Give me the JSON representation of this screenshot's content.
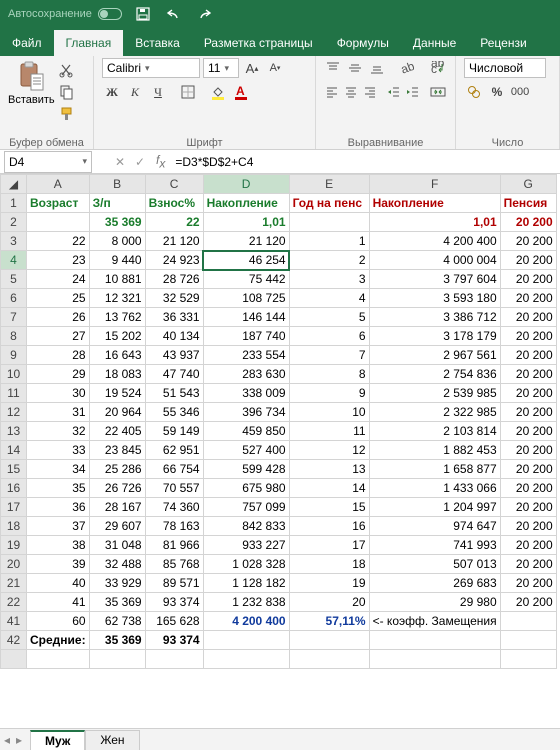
{
  "title_bar": {
    "autosave": "Автосохранение"
  },
  "tabs": [
    "Файл",
    "Главная",
    "Вставка",
    "Разметка страницы",
    "Формулы",
    "Данные",
    "Рецензи"
  ],
  "active_tab": 1,
  "ribbon": {
    "clipboard": {
      "paste": "Вставить",
      "group": "Буфер обмена"
    },
    "font": {
      "name": "Calibri",
      "size": "11",
      "group": "Шрифт",
      "bold": "Ж",
      "italic": "К",
      "underline": "Ч"
    },
    "align": {
      "group": "Выравнивание"
    },
    "number": {
      "format": "Числовой",
      "group": "Число"
    }
  },
  "namebox": "D4",
  "formula": "=D3*$D$2+C4",
  "cols": [
    "A",
    "B",
    "C",
    "D",
    "E",
    "F",
    "G"
  ],
  "row1": [
    "Возраст",
    "З/п",
    "Взнос%",
    "Накопление",
    "Год на пенс",
    "Накопление",
    "Пенсия"
  ],
  "row2": [
    "",
    "35 369",
    "22",
    "1,01",
    "",
    "1,01",
    "20 200"
  ],
  "rows": [
    {
      "n": "3",
      "v": [
        "22",
        "8 000",
        "21 120",
        "21 120",
        "1",
        "4 200 400",
        "20 200"
      ]
    },
    {
      "n": "4",
      "v": [
        "23",
        "9 440",
        "24 923",
        "46 254",
        "2",
        "4 000 004",
        "20 200"
      ]
    },
    {
      "n": "5",
      "v": [
        "24",
        "10 881",
        "28 726",
        "75 442",
        "3",
        "3 797 604",
        "20 200"
      ]
    },
    {
      "n": "6",
      "v": [
        "25",
        "12 321",
        "32 529",
        "108 725",
        "4",
        "3 593 180",
        "20 200"
      ]
    },
    {
      "n": "7",
      "v": [
        "26",
        "13 762",
        "36 331",
        "146 144",
        "5",
        "3 386 712",
        "20 200"
      ]
    },
    {
      "n": "8",
      "v": [
        "27",
        "15 202",
        "40 134",
        "187 740",
        "6",
        "3 178 179",
        "20 200"
      ]
    },
    {
      "n": "9",
      "v": [
        "28",
        "16 643",
        "43 937",
        "233 554",
        "7",
        "2 967 561",
        "20 200"
      ]
    },
    {
      "n": "10",
      "v": [
        "29",
        "18 083",
        "47 740",
        "283 630",
        "8",
        "2 754 836",
        "20 200"
      ]
    },
    {
      "n": "11",
      "v": [
        "30",
        "19 524",
        "51 543",
        "338 009",
        "9",
        "2 539 985",
        "20 200"
      ]
    },
    {
      "n": "12",
      "v": [
        "31",
        "20 964",
        "55 346",
        "396 734",
        "10",
        "2 322 985",
        "20 200"
      ]
    },
    {
      "n": "13",
      "v": [
        "32",
        "22 405",
        "59 149",
        "459 850",
        "11",
        "2 103 814",
        "20 200"
      ]
    },
    {
      "n": "14",
      "v": [
        "33",
        "23 845",
        "62 951",
        "527 400",
        "12",
        "1 882 453",
        "20 200"
      ]
    },
    {
      "n": "15",
      "v": [
        "34",
        "25 286",
        "66 754",
        "599 428",
        "13",
        "1 658 877",
        "20 200"
      ]
    },
    {
      "n": "16",
      "v": [
        "35",
        "26 726",
        "70 557",
        "675 980",
        "14",
        "1 433 066",
        "20 200"
      ]
    },
    {
      "n": "17",
      "v": [
        "36",
        "28 167",
        "74 360",
        "757 099",
        "15",
        "1 204 997",
        "20 200"
      ]
    },
    {
      "n": "18",
      "v": [
        "37",
        "29 607",
        "78 163",
        "842 833",
        "16",
        "974 647",
        "20 200"
      ]
    },
    {
      "n": "19",
      "v": [
        "38",
        "31 048",
        "81 966",
        "933 227",
        "17",
        "741 993",
        "20 200"
      ]
    },
    {
      "n": "20",
      "v": [
        "39",
        "32 488",
        "85 768",
        "1 028 328",
        "18",
        "507 013",
        "20 200"
      ]
    },
    {
      "n": "21",
      "v": [
        "40",
        "33 929",
        "89 571",
        "1 128 182",
        "19",
        "269 683",
        "20 200"
      ]
    },
    {
      "n": "22",
      "v": [
        "41",
        "35 369",
        "93 374",
        "1 232 838",
        "20",
        "29 980",
        "20 200"
      ]
    }
  ],
  "row41": {
    "n": "41",
    "v": [
      "60",
      "62 738",
      "165 628",
      "4 200 400",
      "57,11%",
      "<- коэфф. Замещения",
      ""
    ]
  },
  "row42": {
    "n": "42",
    "label": "Средние:",
    "b": "35 369",
    "c": "93 374"
  },
  "sheet_tabs": [
    "Муж",
    "Жен"
  ],
  "active_sheet": 0
}
